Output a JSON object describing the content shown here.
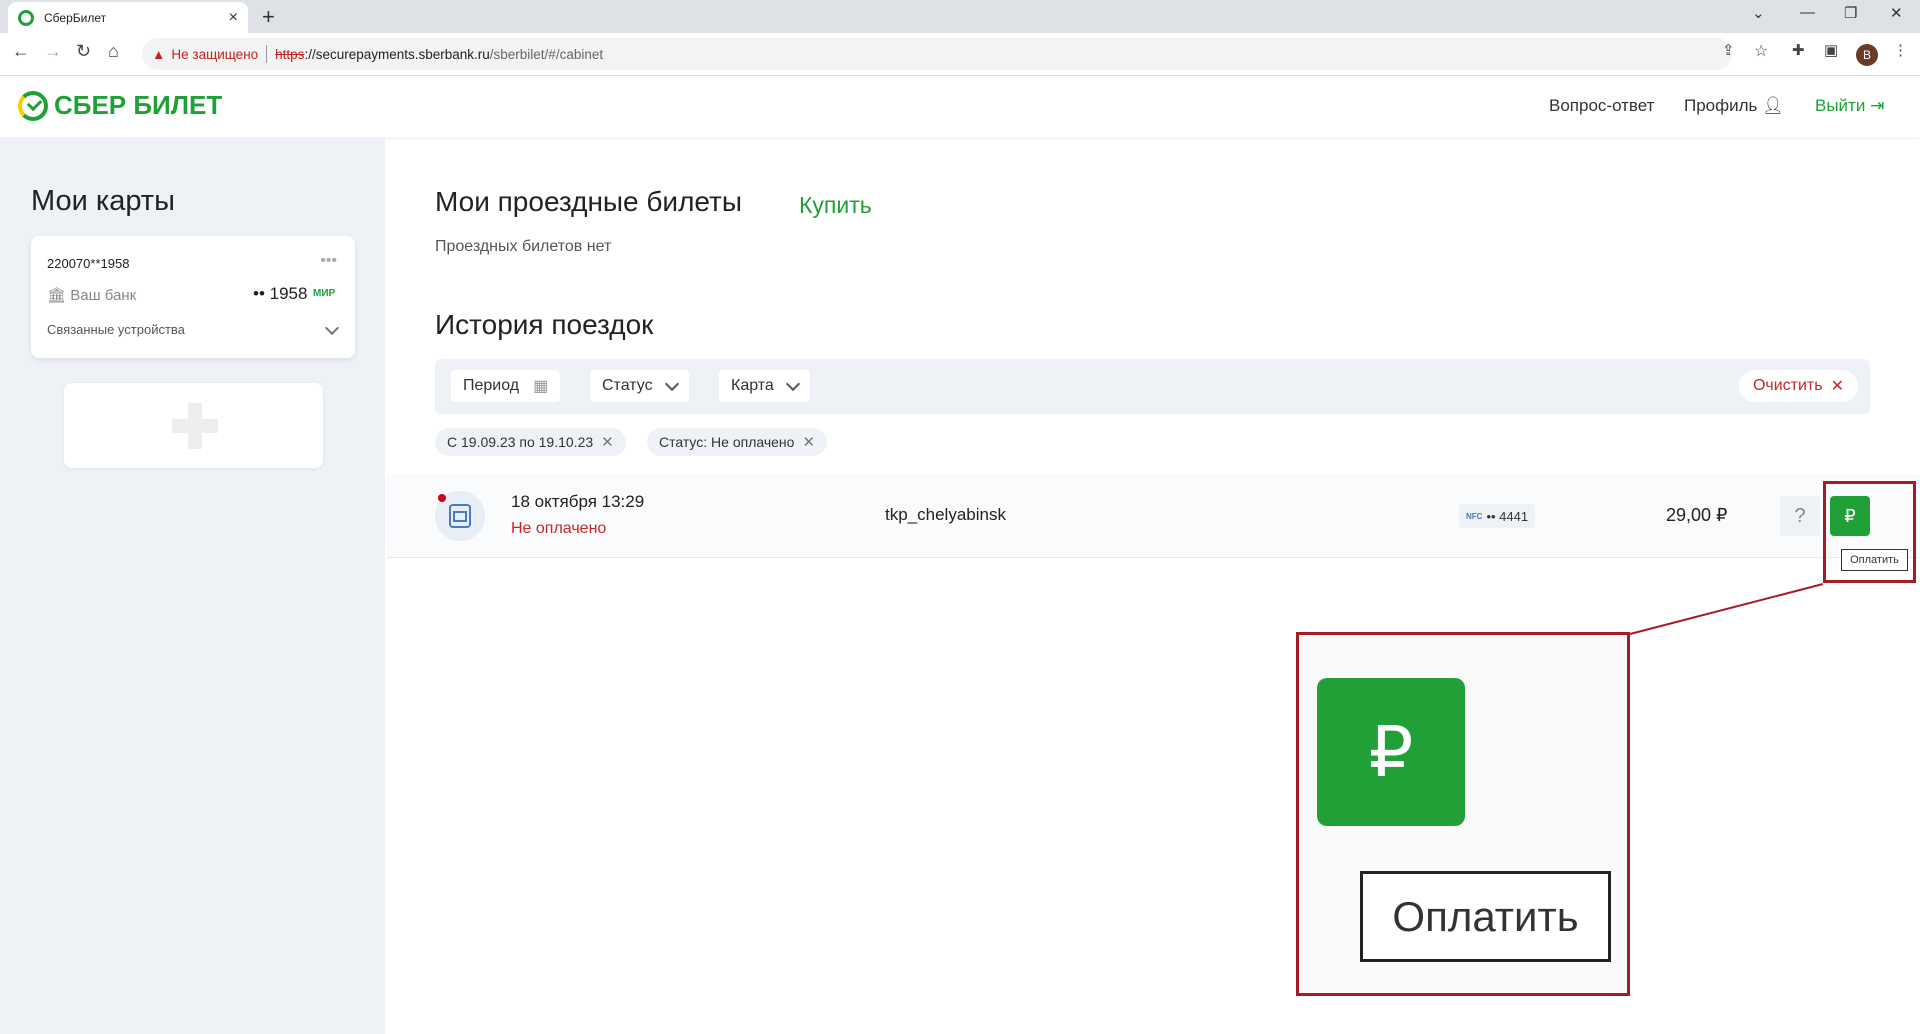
{
  "browser": {
    "tab_title": "СберБилет",
    "new_tab": "+",
    "tab_close": "×",
    "security_label": "Не защищено",
    "url_scheme": "https",
    "url_host": "://securepayments.sberbank.ru",
    "url_path": "/sberbilet/#/cabinet",
    "profile_initial": "B"
  },
  "header": {
    "logo": "СБЕР БИЛЕТ",
    "faq": "Вопрос-ответ",
    "profile": "Профиль",
    "logout": "Выйти"
  },
  "sidebar": {
    "title": "Мои карты",
    "card": {
      "number": "220070**1958",
      "bank": "Ваш банк",
      "last4": "•• 1958",
      "system": "МИР",
      "devices": "Связанные устройства"
    }
  },
  "main": {
    "tickets_title": "Мои проездные билеты",
    "buy": "Купить",
    "no_tickets": "Проездных билетов нет",
    "history_title": "История поездок",
    "filters": {
      "period": "Период",
      "status": "Статус",
      "card": "Карта",
      "clear": "Очистить"
    },
    "chips": [
      "С 19.09.23 по 19.10.23",
      "Статус: Не оплачено"
    ],
    "trips": [
      {
        "datetime": "18 октября 13:29",
        "status": "Не оплачено",
        "carrier": "tkp_chelyabinsk",
        "nfc": "NFC",
        "card": "•• 4441",
        "amount": "29,00 ₽",
        "help": "?",
        "pay_icon": "₽",
        "pay_tooltip": "Оплатить"
      }
    ]
  },
  "colors": {
    "brand": "#21a038",
    "danger": "#c62828",
    "highlight": "#a51c24"
  }
}
